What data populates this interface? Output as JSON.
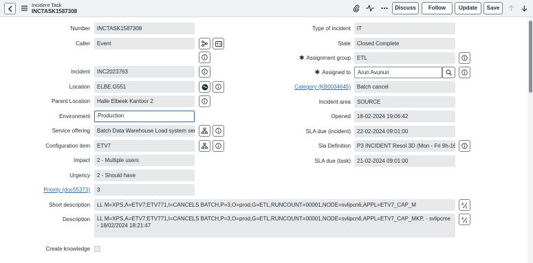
{
  "header": {
    "title": "Incident Task",
    "number": "INCTASK1587308",
    "buttons": {
      "discuss": "Discuss",
      "follow": "Follow",
      "update": "Update",
      "save": "Save"
    }
  },
  "left_fields": {
    "number": {
      "label": "Number",
      "value": "INCTASK1587308"
    },
    "caller": {
      "label": "Caller",
      "value": "Event"
    },
    "incident": {
      "label": "Incident",
      "value": "INC2023763"
    },
    "location": {
      "label": "Location",
      "value": "ELBE.G551"
    },
    "parent_location": {
      "label": "Parent Location",
      "value": "Halle Elbeek Kantoor 2"
    },
    "environment": {
      "label": "Environment",
      "value": "Production"
    },
    "service_offering": {
      "label": "Service offering",
      "value": "Batch Data Warehouse Load system serv"
    },
    "configuration_item": {
      "label": "Configuration item",
      "value": "ETV7"
    },
    "impact": {
      "label": "Impact",
      "value": "2 - Multiple users"
    },
    "urgency": {
      "label": "Urgency",
      "value": "2 - Should have"
    },
    "priority": {
      "label": "Priority (doc55373)",
      "value": "3"
    }
  },
  "right_fields": {
    "type_of_incident": {
      "label": "Type of incident",
      "value": "IT"
    },
    "state": {
      "label": "State",
      "value": "Closed Complete"
    },
    "assignment_group": {
      "label": "Assignment group",
      "value": "ETL"
    },
    "assigned_to": {
      "label": "Assigned to",
      "value": "Arun Avunuri"
    },
    "category": {
      "label": "Category (KB0034645)",
      "value": "Batch cancel"
    },
    "incident_area": {
      "label": "Incident area",
      "value": "SOURCE"
    },
    "opened": {
      "label": "Opened",
      "value": "18-02-2024 19:06:42"
    },
    "sla_due_incident": {
      "label": "SLA due (incident)",
      "value": "22-02-2024 09:01:00"
    },
    "sla_definition": {
      "label": "Sla Definition",
      "value": "P3 INCIDENT Resol 3D (Mon - Fri 9h-16"
    },
    "sla_due_task": {
      "label": "SLA due (task)",
      "value": "21-02-2024 09:01:00"
    }
  },
  "wide_fields": {
    "short_description": {
      "label": "Short description",
      "value": "LL M=XPS,A=ETV7;ETV771,I=CANCELS BATCH,P=3,O=prod,G=ETL,RUNCOUNT=00001,NODE=svlipcn6,APPL=ETV7_CAP_M"
    },
    "description": {
      "label": "Description",
      "value": "LL M=XPS,A=ETV7;ETV771,I=CANCELS BATCH,P=3,O=prod,G=ETL,RUNCOUNT=00001,NODE=svlipcn6,APPL=ETV7_CAP_MKP, - svlipcme - 18/02/2024 18:21:47"
    },
    "create_knowledge": {
      "label": "Create knowledge"
    }
  },
  "required_marker": "✱",
  "colors": {
    "field_bg": "#e6e8ea",
    "link": "#2d6ba3",
    "header_bg": "#f1f2f3"
  }
}
